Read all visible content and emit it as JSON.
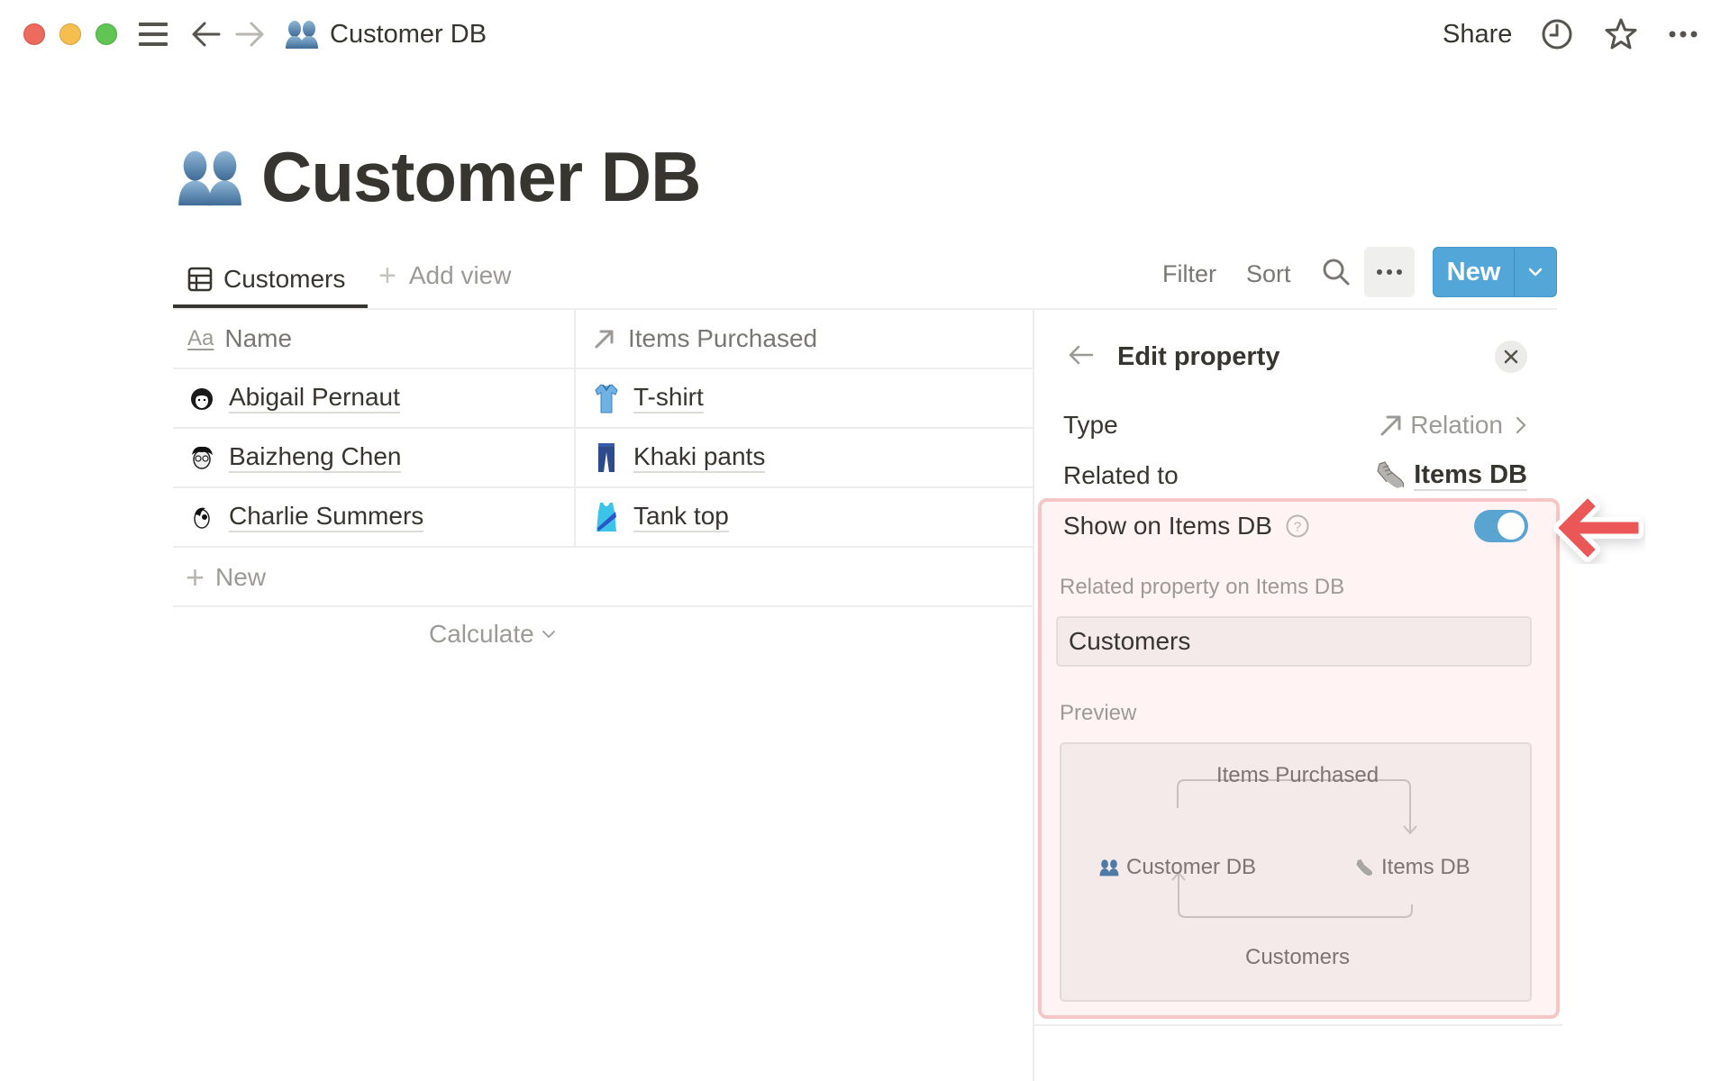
{
  "window": {
    "controls": [
      "close",
      "minimize",
      "maximize"
    ],
    "breadcrumb_icon": "busts-in-silhouette-icon",
    "breadcrumb_title": "Customer DB",
    "share_label": "Share",
    "right_icons": [
      "clock-icon",
      "star-icon",
      "more-icon"
    ]
  },
  "page": {
    "icon": "busts-in-silhouette-icon",
    "title": "Customer DB"
  },
  "views": {
    "active_tab": "Customers",
    "add_view_label": "Add view"
  },
  "toolbar": {
    "filter_label": "Filter",
    "sort_label": "Sort",
    "new_label": "New",
    "colors": {
      "new_button": "#52a7d8"
    }
  },
  "table": {
    "columns": [
      {
        "icon": "text-aa-icon",
        "label": "Name"
      },
      {
        "icon": "relation-arrow-icon",
        "label": "Items Purchased"
      }
    ],
    "rows": [
      {
        "avatar": "woman-avatar-icon",
        "name": "Abigail Pernaut",
        "item_icon": "tshirt-icon",
        "item": "T-shirt"
      },
      {
        "avatar": "man-glasses-avatar-icon",
        "name": "Baizheng Chen",
        "item_icon": "jeans-icon",
        "item": "Khaki pants"
      },
      {
        "avatar": "man-avatar-icon",
        "name": "Charlie Summers",
        "item_icon": "tank-top-icon",
        "item": "Tank top"
      }
    ],
    "new_row_label": "New",
    "calculate_label": "Calculate"
  },
  "panel": {
    "title": "Edit property",
    "type_label": "Type",
    "type_value": "Relation",
    "related_to_label": "Related to",
    "related_to_icon": "shoe-icon",
    "related_to_value": "Items DB",
    "show_on_label": "Show on Items DB",
    "show_on_enabled": true,
    "related_property_label": "Related property on Items DB",
    "related_property_value": "Customers",
    "preview_label": "Preview",
    "preview": {
      "top_relation": "Items Purchased",
      "source_db": "Customer DB",
      "target_db": "Items DB",
      "bottom_relation": "Customers"
    },
    "colors": {
      "highlight_border": "#f6c6c6",
      "highlight_fill": "#fff4f3",
      "toggle_on": "#5aa4d2",
      "callout_arrow": "#eb5757"
    }
  }
}
